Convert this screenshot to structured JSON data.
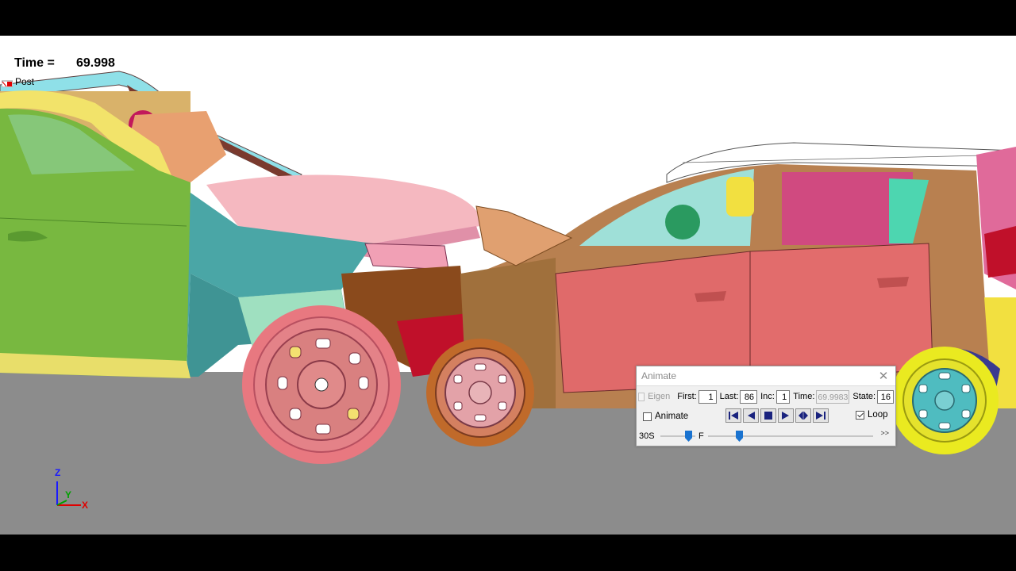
{
  "viewer": {
    "time_label": "Time =",
    "time_value": "69.998",
    "post_label": "Post",
    "axes": {
      "z": "Z",
      "y": "Y",
      "x": "X"
    }
  },
  "animate_dialog": {
    "title": "Animate",
    "eigen_label": "Eigen",
    "first_label": "First:",
    "first_value": "1",
    "last_label": "Last:",
    "last_value": "86",
    "inc_label": "Inc:",
    "inc_value": "1",
    "time_label": "Time:",
    "time_value": "69.9983",
    "state_label": "State:",
    "state_value": "16",
    "animate_label": "Animate",
    "animate_checked": false,
    "loop_label": "Loop",
    "loop_checked": true,
    "speed_label": "30S",
    "frame_label": "F",
    "more_label": ">>"
  },
  "colors": {
    "ground": "#8c8c8c",
    "accent": "#1a73d0",
    "transport_glyph": "#1a237e"
  }
}
